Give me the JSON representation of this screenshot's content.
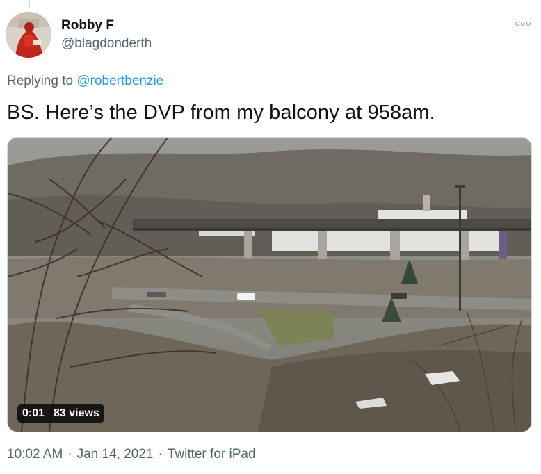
{
  "tweet": {
    "display_name": "Robby F",
    "handle": "@blagdonderth",
    "reply_prefix": "Replying to",
    "reply_to": "@robertbenzie",
    "text": "BS. Here’s the DVP from my balcony at 958am.",
    "more_icon": "more-options-icon"
  },
  "video": {
    "elapsed": "0:01",
    "views": "83 views"
  },
  "footer": {
    "time": "10:02 AM",
    "date": "Jan 14, 2021",
    "source": "Twitter for iPad",
    "separator": "·"
  },
  "colors": {
    "text_primary": "#0f1419",
    "text_secondary": "#536471",
    "link": "#1d9bf0"
  }
}
